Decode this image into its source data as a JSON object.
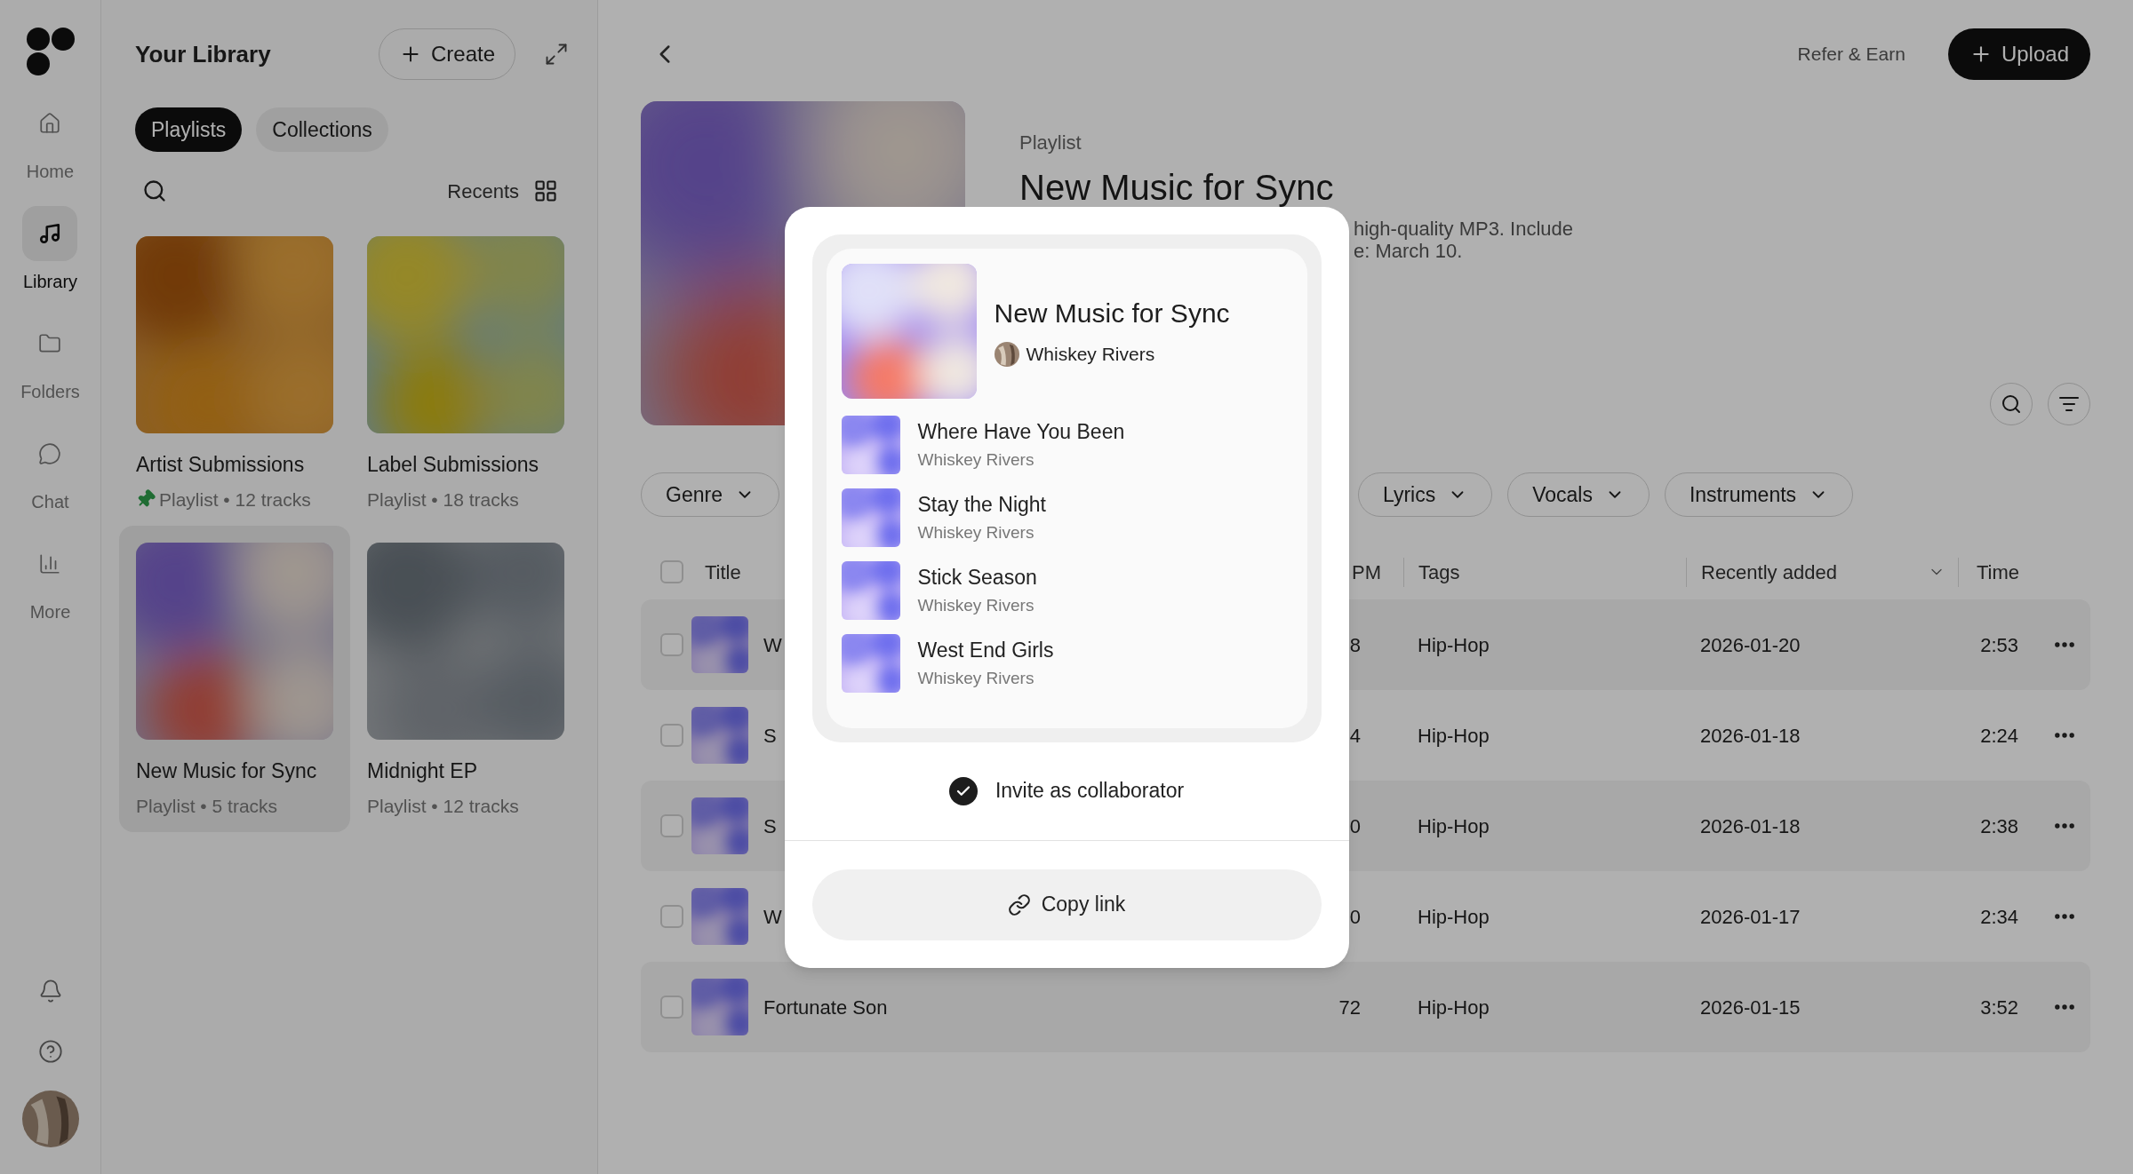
{
  "rail": {
    "items": [
      {
        "kind": "home",
        "label": "Home",
        "selected": false
      },
      {
        "kind": "library",
        "label": "Library",
        "selected": true
      },
      {
        "kind": "folders",
        "label": "Folders",
        "selected": false
      },
      {
        "kind": "chat",
        "label": "Chat",
        "selected": false
      },
      {
        "kind": "more",
        "label": "More",
        "selected": false
      }
    ]
  },
  "library": {
    "title": "Your Library",
    "create_button": "Create",
    "tabs": [
      {
        "label": "Playlists",
        "selected": true
      },
      {
        "label": "Collections",
        "selected": false
      }
    ],
    "sort": "Recents",
    "cards": [
      {
        "title": "Artist Submissions",
        "subtitle": "Playlist • 12 tracks",
        "pinned": true,
        "selected": false
      },
      {
        "title": "Label Submissions",
        "subtitle": "Playlist • 18 tracks",
        "pinned": false,
        "selected": false
      },
      {
        "title": "New Music for Sync",
        "subtitle": "Playlist • 5 tracks",
        "pinned": false,
        "selected": true
      },
      {
        "title": "Midnight EP",
        "subtitle": "Playlist • 12 tracks",
        "pinned": false,
        "selected": false
      }
    ]
  },
  "header": {
    "refer_link": "Refer & Earn",
    "upload_button": "Upload",
    "type": "Playlist",
    "title": "New Music for Sync",
    "description": [
      "high-quality MP3. Include",
      "e: March 10."
    ]
  },
  "filters": [
    "Genre",
    "Lyrics",
    "Vocals",
    "Instruments"
  ],
  "table": {
    "select_all": {
      "checked": false
    },
    "columns": [
      "Title",
      "PM",
      "Tags",
      "Recently added",
      "Time"
    ],
    "rows": [
      {
        "title": "W",
        "bpm": "8",
        "tag": "Hip-Hop",
        "added": "2026-01-20",
        "time": "2:53",
        "checked": false
      },
      {
        "title": "S",
        "bpm": "4",
        "tag": "Hip-Hop",
        "added": "2026-01-18",
        "time": "2:24",
        "checked": false
      },
      {
        "title": "S",
        "bpm": "0",
        "tag": "Hip-Hop",
        "added": "2026-01-18",
        "time": "2:38",
        "checked": false
      },
      {
        "title": "W",
        "bpm": "0",
        "tag": "Hip-Hop",
        "added": "2026-01-17",
        "time": "2:34",
        "checked": false
      },
      {
        "title": "Fortunate Son",
        "bpm": "72",
        "tag": "Hip-Hop",
        "added": "2026-01-15",
        "time": "3:52",
        "checked": false
      }
    ]
  },
  "share_dialog": {
    "title": "New Music for Sync",
    "owner": "Whiskey Rivers",
    "tracks": [
      {
        "title": "Where Have You Been",
        "artist": "Whiskey Rivers"
      },
      {
        "title": "Stay the Night",
        "artist": "Whiskey Rivers"
      },
      {
        "title": "Stick Season",
        "artist": "Whiskey Rivers"
      },
      {
        "title": "West End Girls",
        "artist": "Whiskey Rivers"
      }
    ],
    "invite": {
      "label": "Invite as collaborator",
      "checked": true
    },
    "copy_button": "Copy link"
  }
}
